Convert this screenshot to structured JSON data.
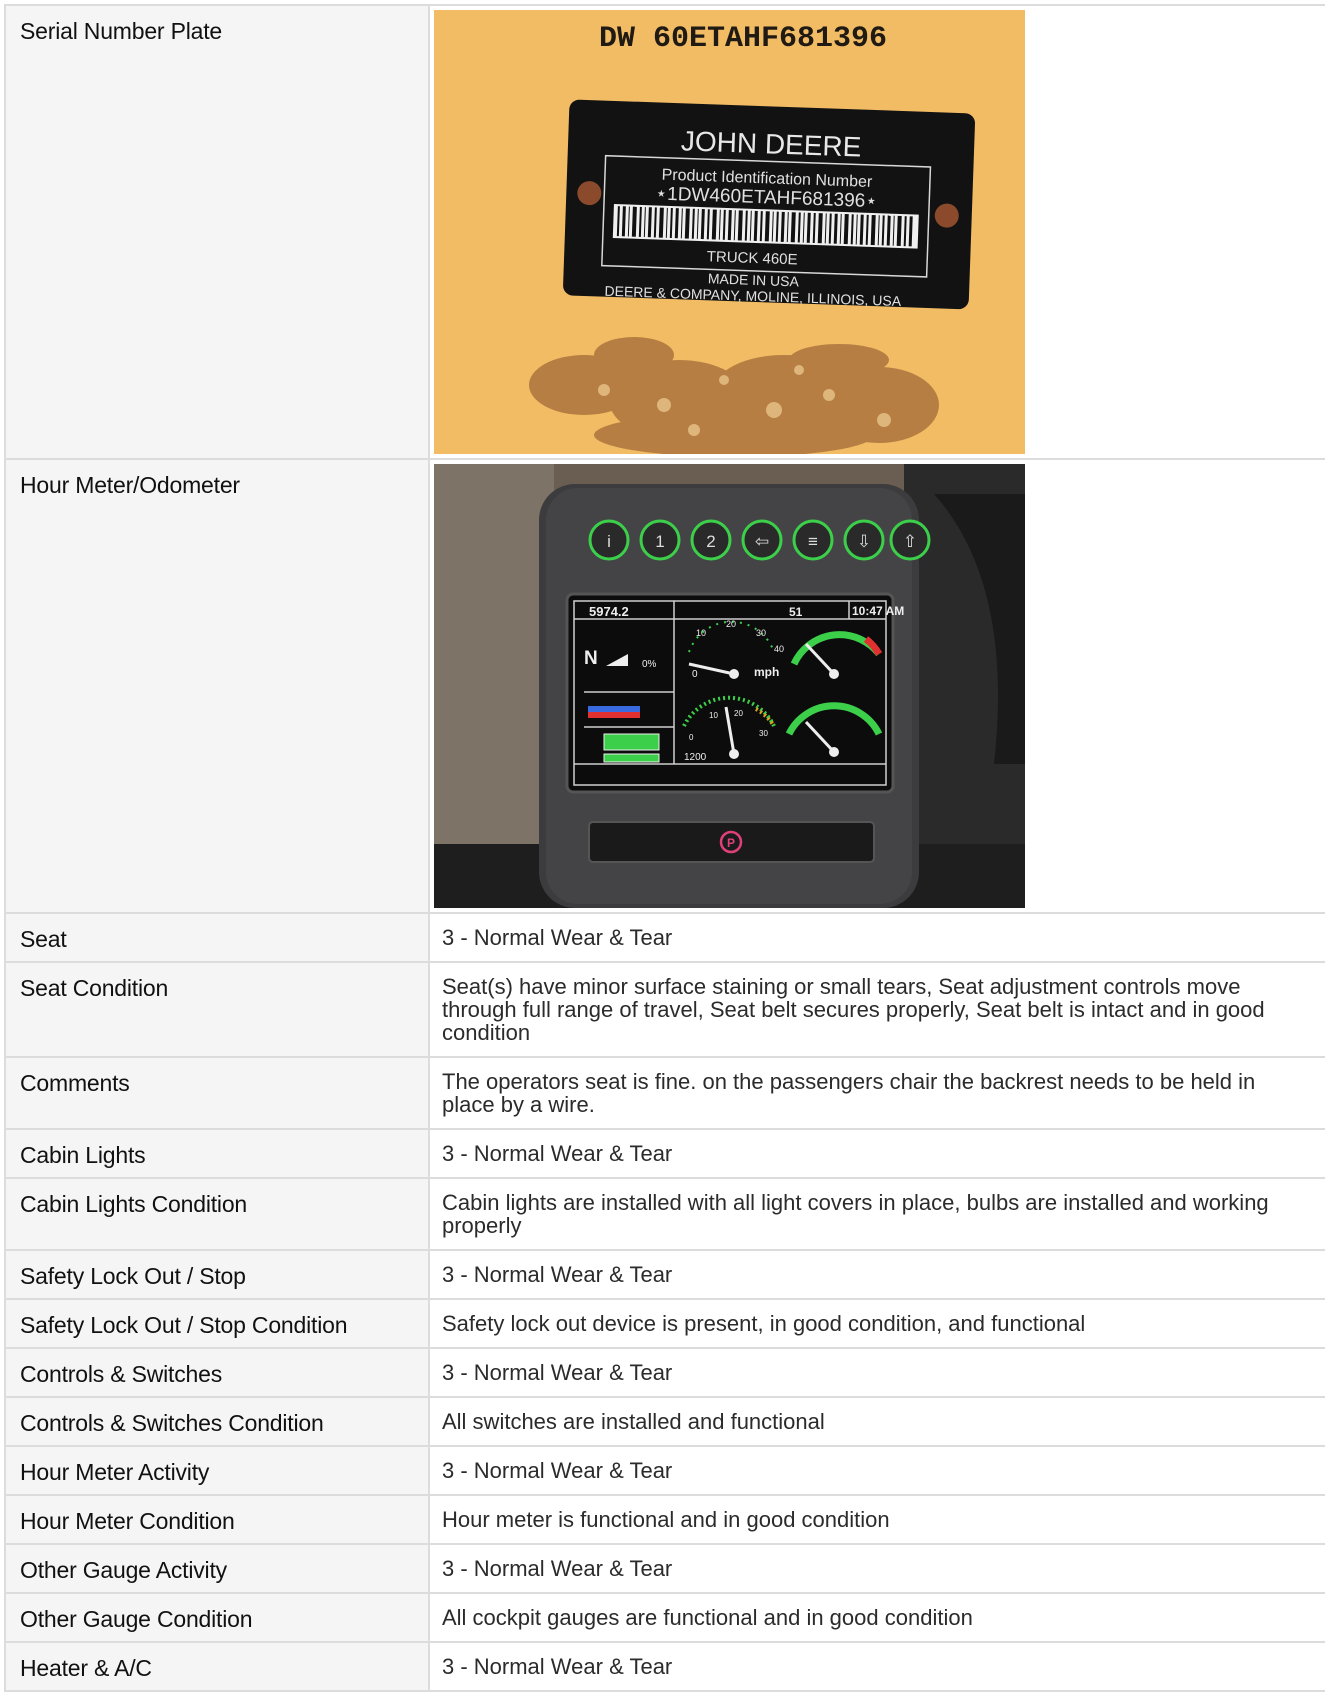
{
  "rows": [
    {
      "label": "Serial Number Plate",
      "kind": "image"
    },
    {
      "label": "Hour Meter/Odometer",
      "kind": "image"
    },
    {
      "label": "Seat",
      "value": "3 - Normal Wear & Tear"
    },
    {
      "label": "Seat Condition",
      "value": "Seat(s) have minor surface staining or small tears, Seat adjustment controls move through full range of travel, Seat belt secures properly, Seat belt is intact and in good condition"
    },
    {
      "label": "Comments",
      "value": "The operators seat is fine. on the passengers chair the backrest needs to be held in place by a wire."
    },
    {
      "label": "Cabin Lights",
      "value": "3 - Normal Wear & Tear"
    },
    {
      "label": "Cabin Lights Condition",
      "value": "Cabin lights are installed with all light covers in place, bulbs are installed and working properly"
    },
    {
      "label": "Safety Lock Out / Stop",
      "value": "3 - Normal Wear & Tear"
    },
    {
      "label": "Safety Lock Out / Stop Condition",
      "value": "Safety lock out device is present, in good condition, and functional"
    },
    {
      "label": "Controls & Switches",
      "value": "3 - Normal Wear & Tear"
    },
    {
      "label": "Controls & Switches Condition",
      "value": "All switches are installed and functional"
    },
    {
      "label": "Hour Meter Activity",
      "value": "3 - Normal Wear & Tear"
    },
    {
      "label": "Hour Meter Condition",
      "value": "Hour meter is functional and in good condition"
    },
    {
      "label": "Other Gauge Activity",
      "value": "3 - Normal Wear & Tear"
    },
    {
      "label": "Other Gauge Condition",
      "value": "All cockpit gauges are functional and in good condition"
    },
    {
      "label": "Heater & A/C",
      "value": "3 - Normal Wear & Tear"
    }
  ],
  "serial_plate_photo": {
    "top_stamp": "DW 60ETAHF681396",
    "brand": "JOHN DEERE",
    "pin_heading": "Product Identification Number",
    "pin": "⋆1DW460ETAHF681396⋆",
    "model": "TRUCK 460E",
    "made_in": "MADE IN USA",
    "maker": "DEERE & COMPANY, MOLINE, ILLINOIS, USA"
  },
  "dash_photo": {
    "hours": "5974.2",
    "temp": "51",
    "time": "10:47 AM",
    "gear": "N",
    "pct": "0%",
    "speed_unit": "mph",
    "speed_ticks": [
      "0",
      "10",
      "20",
      "30",
      "40"
    ],
    "rpm_ticks": [
      "0",
      "10",
      "20",
      "30"
    ],
    "rpm_value": "1200",
    "buttons": [
      "i",
      "1",
      "2",
      "⇦",
      "≡",
      "⇩",
      "⇧"
    ]
  },
  "colors": {
    "plate_bg": "#f0b75a",
    "dash_bezel": "#3c3c3e",
    "screen_bg": "#0c0c0c",
    "gauge_green": "#3ccf4a",
    "gauge_red": "#e03030"
  }
}
